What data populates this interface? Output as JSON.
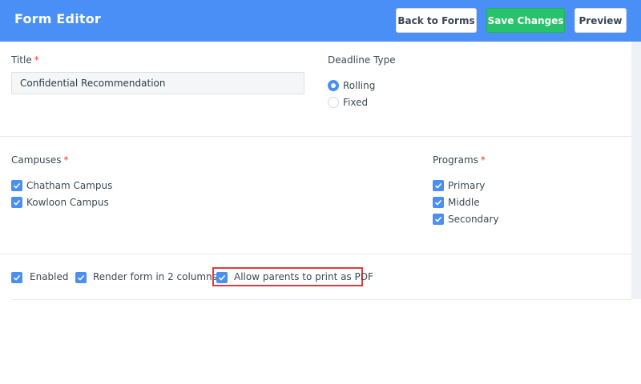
{
  "header": {
    "title": "Form Editor",
    "back_label": "Back to Forms",
    "save_label": "Save Changes",
    "preview_label": "Preview"
  },
  "form": {
    "title_label": "Title",
    "title_value": "Confidential Recommendation",
    "deadline_label": "Deadline Type",
    "deadline_options": [
      "Rolling",
      "Fixed"
    ],
    "deadline_selected": "Rolling",
    "campuses_label": "Campuses",
    "campuses": [
      "Chatham Campus",
      "Kowloon Campus"
    ],
    "programs_label": "Programs",
    "programs": [
      "Primary",
      "Middle",
      "Secondary"
    ],
    "options": [
      "Enabled",
      "Render form in 2 columns",
      "Allow parents to print as PDF"
    ],
    "required_mark": "*"
  },
  "colors": {
    "header_bg": "#4a8ff5",
    "save_button": "#27c26b",
    "checkbox": "#4a8ff5",
    "required": "#e53935",
    "highlight": "#e03b3b"
  }
}
